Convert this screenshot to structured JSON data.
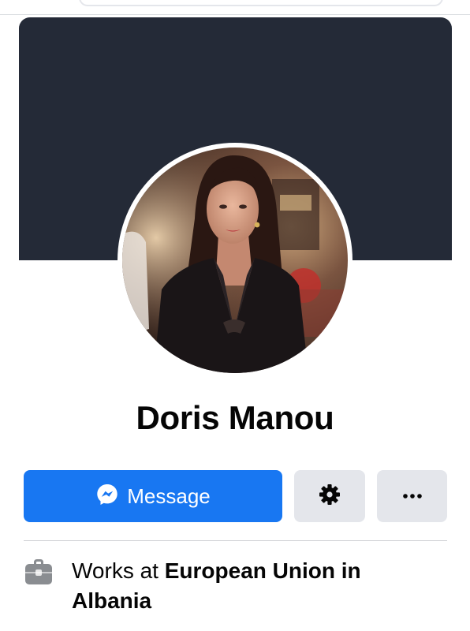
{
  "profile": {
    "name": "Doris Manou"
  },
  "actions": {
    "message_label": "Message",
    "settings_icon": "gear-icon",
    "more_icon": "more-horizontal-icon",
    "message_icon": "messenger-icon"
  },
  "info": {
    "work_prefix": "Works at ",
    "work_employer": "European Union in Albania",
    "work_icon": "briefcase-icon"
  },
  "colors": {
    "cover": "#242a37",
    "primary_button": "#1877f2",
    "secondary_button": "#e4e6eb"
  }
}
